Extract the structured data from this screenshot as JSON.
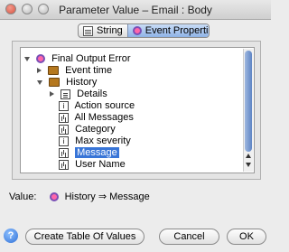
{
  "window": {
    "title": "Parameter Value – Email : Body"
  },
  "tabs": [
    {
      "label": "String",
      "selected": false
    },
    {
      "label": "Event Properties",
      "selected": true
    }
  ],
  "tree": {
    "root": "Final Output Error",
    "items": [
      {
        "label": "Event time"
      },
      {
        "label": "History"
      },
      {
        "label": "Details"
      },
      {
        "label": "Action source"
      },
      {
        "label": "All Messages"
      },
      {
        "label": "Category"
      },
      {
        "label": "Max severity"
      },
      {
        "label": "Message",
        "selected": true
      },
      {
        "label": "User Name"
      }
    ]
  },
  "value": {
    "label": "Value:",
    "path_part1": "History",
    "arrow": "⇒",
    "path_part2": "Message"
  },
  "buttons": {
    "help": "?",
    "create_table": "Create Table Of Values",
    "cancel": "Cancel",
    "ok": "OK"
  },
  "colors": {
    "selection": "#3875d7",
    "scroll_thumb": "#5e84c4"
  }
}
